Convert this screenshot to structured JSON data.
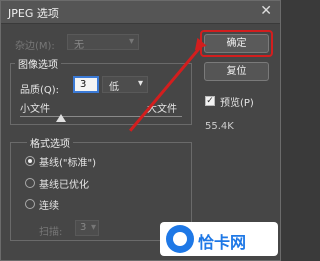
{
  "window": {
    "title": "JPEG 选项",
    "close_glyph": "✕"
  },
  "matte": {
    "label": "杂边(M):",
    "value": "无"
  },
  "image_options": {
    "group_label": "图像选项",
    "quality_label": "品质(Q):",
    "quality_value": "3",
    "quality_preset": "低",
    "small_file_label": "小文件",
    "large_file_label": "大文件",
    "quality_slider_fraction": 0.25
  },
  "format_options": {
    "group_label": "格式选项",
    "options": [
      "基线(\"标准\")",
      "基线已优化",
      "连续"
    ],
    "selected_index": 0,
    "scans_label": "扫描:",
    "scans_value": "3"
  },
  "buttons": {
    "ok": "确定",
    "reset": "复位"
  },
  "preview": {
    "label": "预览(P)",
    "checked": true,
    "file_size": "55.4K"
  },
  "watermark": {
    "text": "恰卡网"
  },
  "colors": {
    "highlight": "#d31e1e",
    "brand_blue": "#1e78e6"
  }
}
